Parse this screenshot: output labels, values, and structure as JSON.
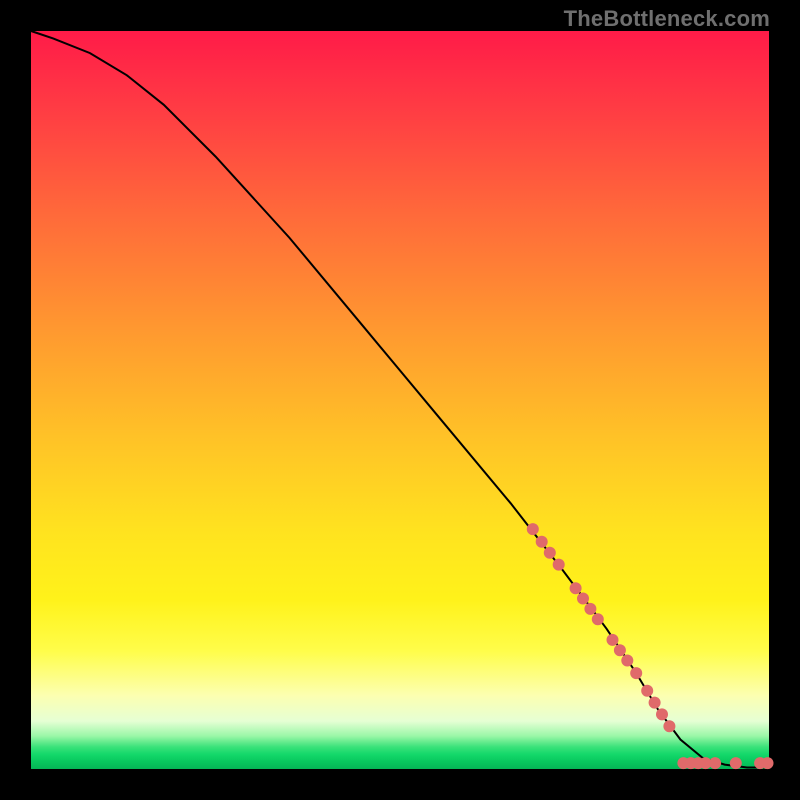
{
  "watermark": "TheBottleneck.com",
  "chart_data": {
    "type": "line",
    "title": "",
    "xlabel": "",
    "ylabel": "",
    "xlim": [
      0,
      100
    ],
    "ylim": [
      0,
      100
    ],
    "grid": false,
    "legend": false,
    "series": [
      {
        "name": "bottleneck-curve",
        "x": [
          0,
          3,
          8,
          13,
          18,
          25,
          35,
          45,
          55,
          65,
          72,
          78,
          82,
          85,
          88,
          91,
          94,
          97,
          100
        ],
        "y": [
          100,
          99,
          97,
          94,
          90,
          83,
          72,
          60,
          48,
          36,
          27,
          19,
          13,
          8,
          4,
          1.5,
          0.6,
          0.2,
          0.2
        ],
        "stroke": "#000000",
        "stroke_width": 2
      }
    ],
    "markers": {
      "name": "highlighted-points",
      "color": "#e06a6a",
      "radius": 6,
      "points": [
        {
          "x": 68.0,
          "y": 32.5
        },
        {
          "x": 69.2,
          "y": 30.8
        },
        {
          "x": 70.3,
          "y": 29.3
        },
        {
          "x": 71.5,
          "y": 27.7
        },
        {
          "x": 73.8,
          "y": 24.5
        },
        {
          "x": 74.8,
          "y": 23.1
        },
        {
          "x": 75.8,
          "y": 21.7
        },
        {
          "x": 76.8,
          "y": 20.3
        },
        {
          "x": 78.8,
          "y": 17.5
        },
        {
          "x": 79.8,
          "y": 16.1
        },
        {
          "x": 80.8,
          "y": 14.7
        },
        {
          "x": 82.0,
          "y": 13.0
        },
        {
          "x": 83.5,
          "y": 10.6
        },
        {
          "x": 84.5,
          "y": 9.0
        },
        {
          "x": 85.5,
          "y": 7.4
        },
        {
          "x": 86.5,
          "y": 5.8
        },
        {
          "x": 88.4,
          "y": 0.8
        },
        {
          "x": 89.4,
          "y": 0.8
        },
        {
          "x": 90.4,
          "y": 0.8
        },
        {
          "x": 91.4,
          "y": 0.8
        },
        {
          "x": 92.7,
          "y": 0.8
        },
        {
          "x": 95.5,
          "y": 0.8
        },
        {
          "x": 98.8,
          "y": 0.8
        },
        {
          "x": 99.8,
          "y": 0.8
        }
      ]
    }
  }
}
